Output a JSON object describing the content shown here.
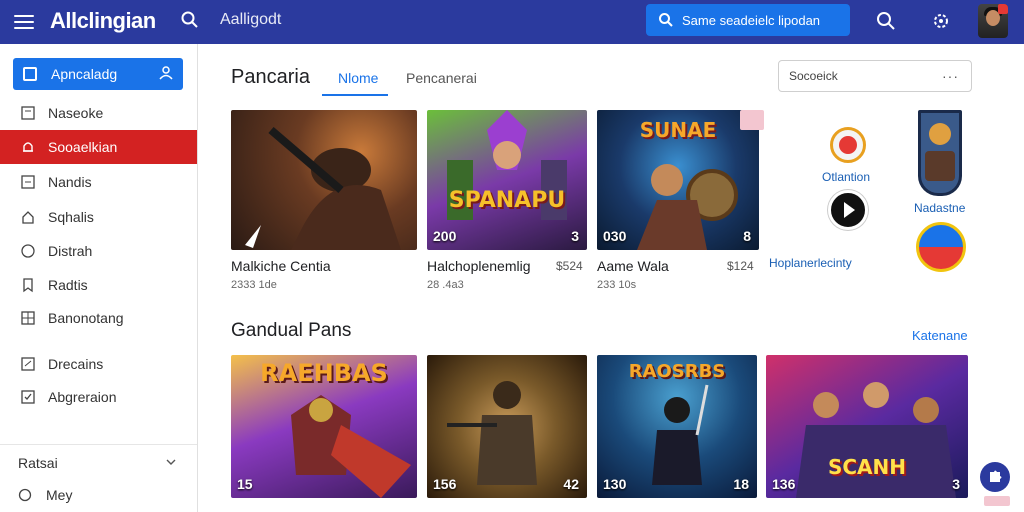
{
  "topbar": {
    "logo": "Allclingian",
    "search_text": "Aalligodt",
    "search_pill": "Same seadeielc lipodan",
    "icons": [
      "menu-icon",
      "search-icon",
      "search-icon",
      "settings-icon"
    ]
  },
  "sidebar": {
    "primary": "Apncaladg",
    "items": [
      {
        "label": "Naseoke",
        "icon": "square-icon"
      },
      {
        "label": "Sooaelkian",
        "icon": "bell-icon",
        "active": true
      },
      {
        "label": "Nandis",
        "icon": "square-icon"
      },
      {
        "label": "Sqhalis",
        "icon": "home-icon"
      },
      {
        "label": "Distrah",
        "icon": "circle-icon"
      },
      {
        "label": "Radtis",
        "icon": "bookmark-icon"
      },
      {
        "label": "Banonotang",
        "icon": "grid-icon"
      },
      {
        "label": "Drecains",
        "icon": "square-icon"
      },
      {
        "label": "Abgreraion",
        "icon": "check-icon"
      }
    ],
    "section_title": "Ratsai",
    "section_item": "Mey"
  },
  "main": {
    "title": "Pancaria",
    "tabs": [
      {
        "label": "Nlome",
        "active": true
      },
      {
        "label": "Pencanerai",
        "active": false
      }
    ],
    "search_placeholder": "Socoeick",
    "cards_row1": [
      {
        "title": "Malkiche Centia",
        "meta": "2333 1de",
        "count_l": "",
        "count_r": "",
        "price": ""
      },
      {
        "title": "Halchoplenemlig",
        "price": "$524",
        "meta": "28 .4a3",
        "count_l": "200",
        "count_r": "3",
        "art": "SPANAPU"
      },
      {
        "title": "Aame Wala",
        "price": "$124",
        "meta": "233 10s",
        "count_l": "030",
        "count_r": "8",
        "art": "SUNAE"
      }
    ],
    "side_apps": [
      {
        "label": "Otlantion"
      },
      {
        "label": "Hoplanerlecinty"
      },
      {
        "label": "Nadastne"
      }
    ],
    "section2_title": "Gandual Pans",
    "view_link": "Katenane",
    "cards_row2": [
      {
        "count_l": "15",
        "count_r": "",
        "art": "RAEHBAS"
      },
      {
        "count_l": "156",
        "count_r": "42",
        "art": ""
      },
      {
        "count_l": "130",
        "count_r": "18",
        "art": "RAOSRBS"
      },
      {
        "count_l": "136",
        "count_r": "3",
        "art": "SCANH"
      }
    ]
  },
  "colors": {
    "topbar": "#2b3a9e",
    "accent": "#1a73e8",
    "active": "#d32222"
  }
}
